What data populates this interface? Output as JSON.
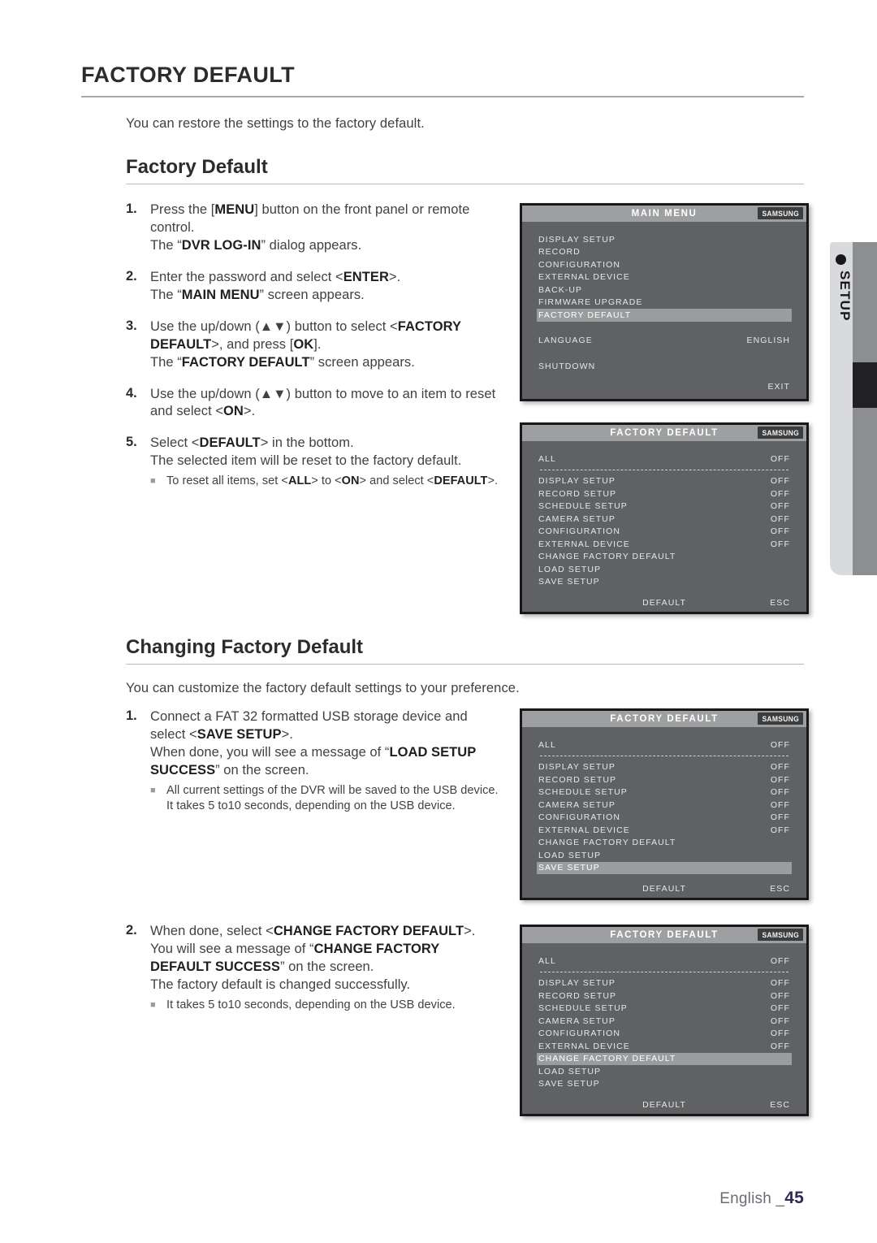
{
  "page": {
    "heading": "FACTORY DEFAULT",
    "intro": "You can restore the settings to the factory default.",
    "footer_language": "English _",
    "footer_page": "45"
  },
  "side_tab": {
    "label": "SETUP",
    "dot_icon": "bullet-dot-icon",
    "colors": {
      "light": "#d8dadc",
      "dark_strip": "#8c8e90",
      "dark_block": "#212123"
    }
  },
  "section1": {
    "title": "Factory Default",
    "steps": [
      {
        "num": "1.",
        "lines": [
          [
            {
              "t": "Press the [",
              "b": false
            },
            {
              "t": "MENU",
              "b": true
            },
            {
              "t": "] button on the front panel or remote",
              "b": false
            }
          ],
          [
            {
              "t": "control.",
              "b": false
            }
          ],
          [
            {
              "t": "The “",
              "b": false
            },
            {
              "t": "DVR LOG-IN",
              "b": true
            },
            {
              "t": "” dialog appears.",
              "b": false
            }
          ]
        ]
      },
      {
        "num": "2.",
        "lines": [
          [
            {
              "t": "Enter the password and select <",
              "b": false
            },
            {
              "t": "ENTER",
              "b": true
            },
            {
              "t": ">.",
              "b": false
            }
          ],
          [
            {
              "t": "The “",
              "b": false
            },
            {
              "t": "MAIN MENU",
              "b": true
            },
            {
              "t": "” screen appears.",
              "b": false
            }
          ]
        ]
      },
      {
        "num": "3.",
        "lines": [
          [
            {
              "t": "Use the up/down (▲▼) button to select <",
              "b": false
            },
            {
              "t": "FACTORY",
              "b": true
            }
          ],
          [
            {
              "t": "DEFAULT",
              "b": true
            },
            {
              "t": ">, and press [",
              "b": false
            },
            {
              "t": "OK",
              "b": true
            },
            {
              "t": "].",
              "b": false
            }
          ],
          [
            {
              "t": "The “",
              "b": false
            },
            {
              "t": "FACTORY DEFAULT",
              "b": true
            },
            {
              "t": "” screen appears.",
              "b": false
            }
          ]
        ]
      },
      {
        "num": "4.",
        "lines": [
          [
            {
              "t": "Use the up/down (▲▼) button to move to an item to reset",
              "b": false
            }
          ],
          [
            {
              "t": "and select <",
              "b": false
            },
            {
              "t": "ON",
              "b": true
            },
            {
              "t": ">.",
              "b": false
            }
          ]
        ]
      },
      {
        "num": "5.",
        "lines": [
          [
            {
              "t": "Select <",
              "b": false
            },
            {
              "t": "DEFAULT",
              "b": true
            },
            {
              "t": "> in the bottom.",
              "b": false
            }
          ],
          [
            {
              "t": "The selected item will be reset to the factory default.",
              "b": false
            }
          ]
        ],
        "notes": [
          [
            {
              "t": "To reset all items, set <",
              "b": false
            },
            {
              "t": "ALL",
              "b": true
            },
            {
              "t": "> to <",
              "b": false
            },
            {
              "t": "ON",
              "b": true
            },
            {
              "t": "> and select <",
              "b": false
            },
            {
              "t": "DEFAULT",
              "b": true
            },
            {
              "t": ">.",
              "b": false
            }
          ]
        ]
      }
    ]
  },
  "section2": {
    "title": "Changing Factory Default",
    "intro": "You can customize the factory default settings to your preference.",
    "steps": [
      {
        "num": "1.",
        "lines": [
          [
            {
              "t": "Connect a FAT 32 formatted USB storage device and",
              "b": false
            }
          ],
          [
            {
              "t": "select <",
              "b": false
            },
            {
              "t": "SAVE SETUP",
              "b": true
            },
            {
              "t": ">.",
              "b": false
            }
          ],
          [
            {
              "t": "When done, you will see a message of “",
              "b": false
            },
            {
              "t": "LOAD SETUP",
              "b": true
            }
          ],
          [
            {
              "t": "SUCCESS",
              "b": true
            },
            {
              "t": "” on the screen.",
              "b": false
            }
          ]
        ],
        "notes": [
          [
            {
              "t": "All current settings of the DVR will be saved to the USB device.",
              "b": false
            }
          ],
          [
            {
              "t": "It takes 5 to10 seconds, depending on the USB device.",
              "b": false
            }
          ]
        ]
      },
      {
        "num": "2.",
        "lines": [
          [
            {
              "t": "When done, select <",
              "b": false
            },
            {
              "t": "CHANGE FACTORY DEFAULT",
              "b": true
            },
            {
              "t": ">.",
              "b": false
            }
          ],
          [
            {
              "t": "You will see a message of “",
              "b": false
            },
            {
              "t": "CHANGE FACTORY",
              "b": true
            }
          ],
          [
            {
              "t": "DEFAULT SUCCESS",
              "b": true
            },
            {
              "t": "” on the screen.",
              "b": false
            }
          ],
          [
            {
              "t": "The factory default is changed successfully.",
              "b": false
            }
          ]
        ],
        "notes": [
          [
            {
              "t": "It takes 5 to10 seconds, depending on the USB device.",
              "b": false
            }
          ]
        ]
      }
    ]
  },
  "osd_panels": [
    {
      "id": "main-menu",
      "title": "MAIN MENU",
      "brand": "SAMSUNG",
      "rows": [
        {
          "label": "DISPLAY SETUP",
          "value": "",
          "highlight": false
        },
        {
          "label": "RECORD",
          "value": "",
          "highlight": false
        },
        {
          "label": "CONFIGURATION",
          "value": "",
          "highlight": false
        },
        {
          "label": "EXTERNAL DEVICE",
          "value": "",
          "highlight": false
        },
        {
          "label": "BACK-UP",
          "value": "",
          "highlight": false
        },
        {
          "label": "FIRMWARE UPGRADE",
          "value": "",
          "highlight": false
        },
        {
          "label": "FACTORY DEFAULT",
          "value": "",
          "highlight": true
        },
        {
          "type": "gap"
        },
        {
          "label": "LANGUAGE",
          "value": "ENGLISH",
          "highlight": false
        },
        {
          "type": "gap"
        },
        {
          "label": "SHUTDOWN",
          "value": "",
          "highlight": false
        }
      ],
      "footer": {
        "center": "",
        "right": "EXIT"
      }
    },
    {
      "id": "factory-default-1",
      "title": "FACTORY DEFAULT",
      "brand": "SAMSUNG",
      "rows": [
        {
          "label": "ALL",
          "value": "OFF",
          "highlight": false
        },
        {
          "type": "sep"
        },
        {
          "label": "DISPLAY SETUP",
          "value": "OFF",
          "highlight": false
        },
        {
          "label": "RECORD SETUP",
          "value": "OFF",
          "highlight": false
        },
        {
          "label": "SCHEDULE SETUP",
          "value": "OFF",
          "highlight": false
        },
        {
          "label": "CAMERA SETUP",
          "value": "OFF",
          "highlight": false
        },
        {
          "label": "CONFIGURATION",
          "value": "OFF",
          "highlight": false
        },
        {
          "label": "EXTERNAL DEVICE",
          "value": "OFF",
          "highlight": false
        },
        {
          "label": "CHANGE FACTORY DEFAULT",
          "value": "",
          "highlight": false
        },
        {
          "label": "LOAD SETUP",
          "value": "",
          "highlight": false
        },
        {
          "label": "SAVE SETUP",
          "value": "",
          "highlight": false
        }
      ],
      "footer": {
        "center": "DEFAULT",
        "right": "ESC"
      }
    },
    {
      "id": "factory-default-2",
      "title": "FACTORY DEFAULT",
      "brand": "SAMSUNG",
      "rows": [
        {
          "label": "ALL",
          "value": "OFF",
          "highlight": false
        },
        {
          "type": "sep"
        },
        {
          "label": "DISPLAY SETUP",
          "value": "OFF",
          "highlight": false
        },
        {
          "label": "RECORD SETUP",
          "value": "OFF",
          "highlight": false
        },
        {
          "label": "SCHEDULE SETUP",
          "value": "OFF",
          "highlight": false
        },
        {
          "label": "CAMERA SETUP",
          "value": "OFF",
          "highlight": false
        },
        {
          "label": "CONFIGURATION",
          "value": "OFF",
          "highlight": false
        },
        {
          "label": "EXTERNAL DEVICE",
          "value": "OFF",
          "highlight": false
        },
        {
          "label": "CHANGE FACTORY DEFAULT",
          "value": "",
          "highlight": false
        },
        {
          "label": "LOAD SETUP",
          "value": "",
          "highlight": false
        },
        {
          "label": "SAVE SETUP",
          "value": "",
          "highlight": true
        }
      ],
      "footer": {
        "center": "DEFAULT",
        "right": "ESC"
      }
    },
    {
      "id": "factory-default-3",
      "title": "FACTORY DEFAULT",
      "brand": "SAMSUNG",
      "rows": [
        {
          "label": "ALL",
          "value": "OFF",
          "highlight": false
        },
        {
          "type": "sep"
        },
        {
          "label": "DISPLAY SETUP",
          "value": "OFF",
          "highlight": false
        },
        {
          "label": "RECORD SETUP",
          "value": "OFF",
          "highlight": false
        },
        {
          "label": "SCHEDULE SETUP",
          "value": "OFF",
          "highlight": false
        },
        {
          "label": "CAMERA SETUP",
          "value": "OFF",
          "highlight": false
        },
        {
          "label": "CONFIGURATION",
          "value": "OFF",
          "highlight": false
        },
        {
          "label": "EXTERNAL DEVICE",
          "value": "OFF",
          "highlight": false
        },
        {
          "label": "CHANGE FACTORY DEFAULT",
          "value": "",
          "highlight": true
        },
        {
          "label": "LOAD SETUP",
          "value": "",
          "highlight": false
        },
        {
          "label": "SAVE SETUP",
          "value": "",
          "highlight": false
        }
      ],
      "footer": {
        "center": "DEFAULT",
        "right": "ESC"
      }
    }
  ]
}
